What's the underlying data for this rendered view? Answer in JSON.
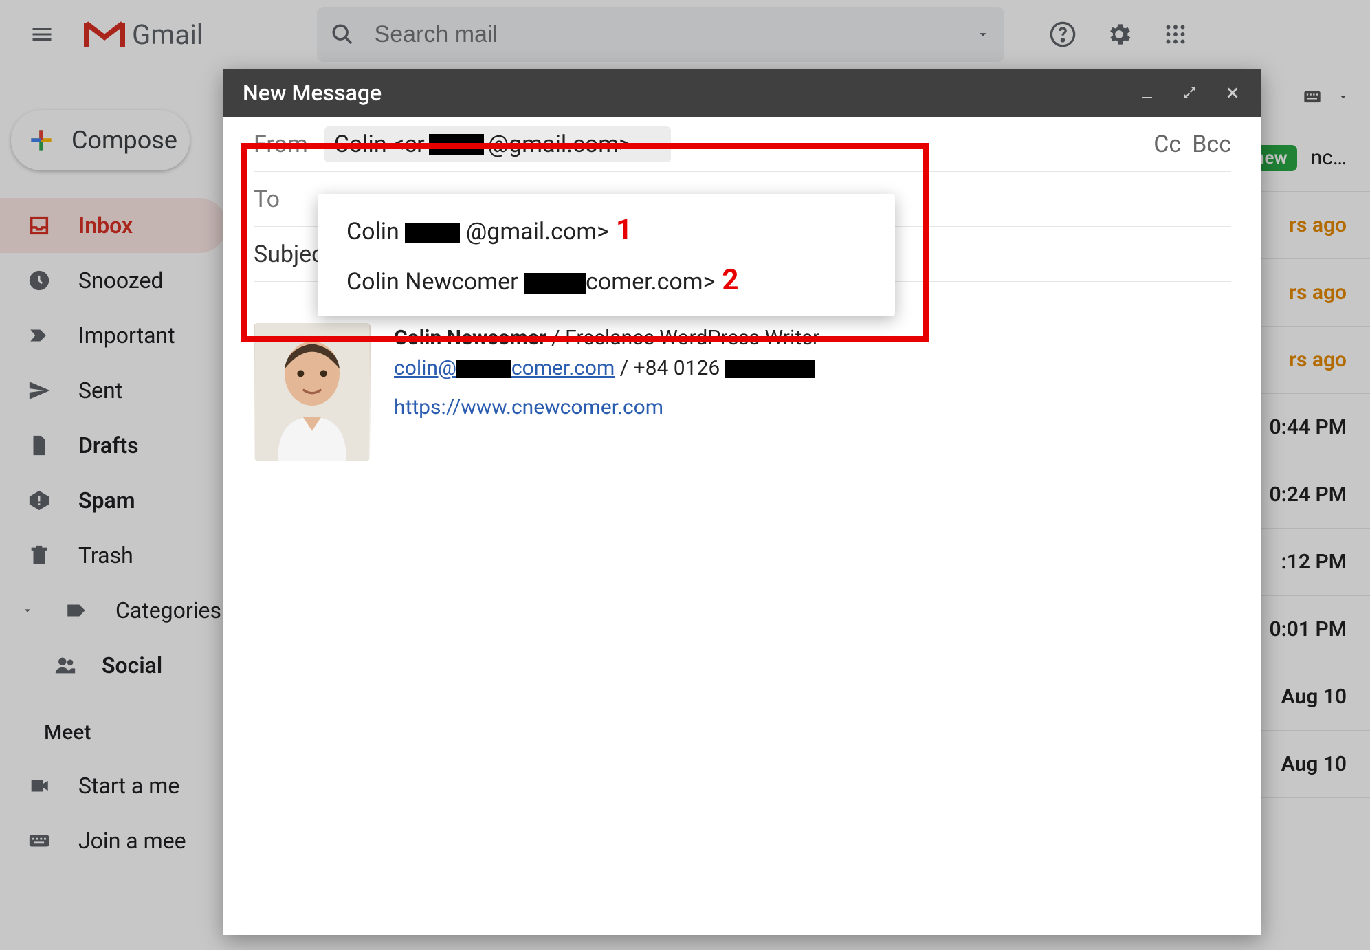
{
  "app_name": "Gmail",
  "search_placeholder": "Search mail",
  "compose_label": "Compose",
  "sidebar": [
    {
      "key": "inbox",
      "label": "Inbox",
      "icon": "inbox-icon",
      "selected": true,
      "bold": true
    },
    {
      "key": "snoozed",
      "label": "Snoozed",
      "icon": "clock-icon"
    },
    {
      "key": "important",
      "label": "Important",
      "icon": "important-icon"
    },
    {
      "key": "sent",
      "label": "Sent",
      "icon": "send-icon"
    },
    {
      "key": "drafts",
      "label": "Drafts",
      "icon": "file-icon",
      "bold": true
    },
    {
      "key": "spam",
      "label": "Spam",
      "icon": "spam-icon",
      "bold": true
    },
    {
      "key": "trash",
      "label": "Trash",
      "icon": "trash-icon"
    },
    {
      "key": "categories",
      "label": "Categories",
      "icon": "label-icon",
      "chevron": true
    },
    {
      "key": "social",
      "label": "Social",
      "icon": "people-icon",
      "sub": true,
      "bold": true
    }
  ],
  "meet": {
    "header": "Meet",
    "start": "Start a me",
    "join": "Join a mee"
  },
  "toolbar_keyboard_icon": "keyboard-icon",
  "mail_rows": [
    {
      "badge": "new",
      "text": "nc…",
      "time": "",
      "t": ""
    },
    {
      "time": "rs ago",
      "highlight": true
    },
    {
      "time": "rs ago",
      "highlight": true
    },
    {
      "time": "rs ago",
      "highlight": true
    },
    {
      "time": "0:44 PM"
    },
    {
      "time": "0:24 PM"
    },
    {
      "time": ":12 PM",
      "bold": true
    },
    {
      "time": "0:01 PM"
    },
    {
      "time": "Aug 10"
    },
    {
      "time": "Aug 10"
    }
  ],
  "compose": {
    "title": "New Message",
    "from_label": "From",
    "from_value_prefix": "Colin <cr",
    "from_value_suffix": " @gmail.com>",
    "to_label": "To",
    "subject_label": "Subjec",
    "cc_label": "Cc",
    "bcc_label": "Bcc",
    "dropdown": [
      {
        "prefix": "Colin <cr",
        "redact_w": 80,
        "suffix": " @gmail.com>",
        "num": "1"
      },
      {
        "prefix": "Colin Newcomer <colin@",
        "redact_w": 90,
        "suffix": "comer.com>",
        "num": "2"
      }
    ],
    "signature": {
      "name": "Colin Newcomer",
      "role": " / Freelance WordPress Writer",
      "email_prefix": "colin@",
      "email_suffix": "comer.com",
      "phone_prefix": " / +84 0126 ",
      "site": "https://www.cnewcomer.com"
    }
  }
}
